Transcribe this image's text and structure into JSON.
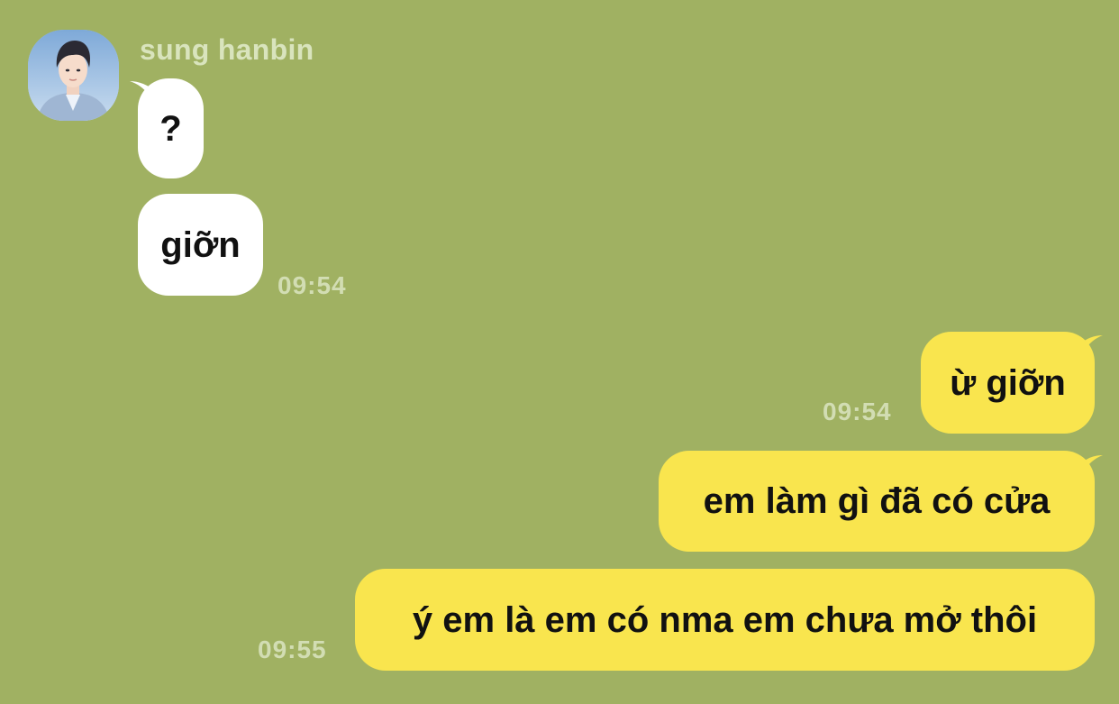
{
  "conversation": {
    "sender": {
      "name": "sung hanbin"
    },
    "incoming": [
      {
        "text": "?"
      },
      {
        "text": "giỡn",
        "time": "09:54"
      }
    ],
    "outgoing": [
      {
        "text": "ừ giỡn",
        "time": "09:54"
      },
      {
        "text": "em làm gì đã có cửa"
      },
      {
        "text": "ý em là em có nma em chưa mở thôi",
        "time": "09:55"
      }
    ]
  },
  "colors": {
    "background": "#a0b162",
    "incoming_bubble": "#ffffff",
    "outgoing_bubble": "#f9e54e",
    "timestamp": "#d2ddb3",
    "sender_name": "#d9e4bd"
  }
}
